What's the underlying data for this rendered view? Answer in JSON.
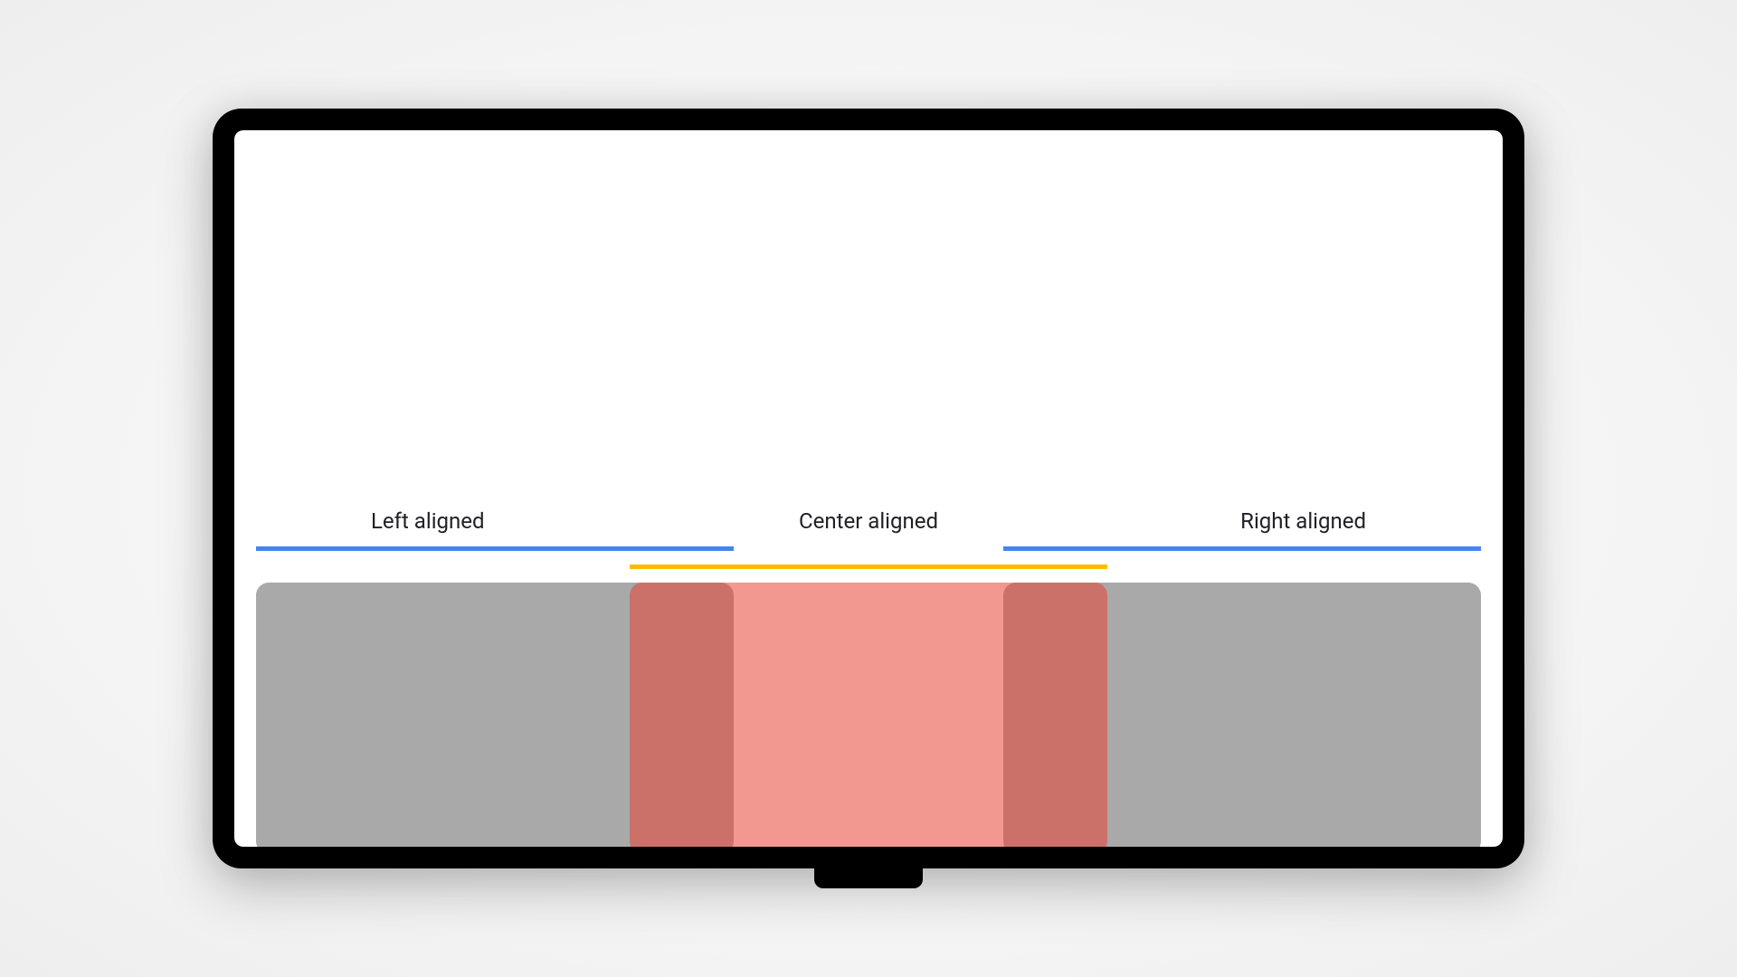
{
  "labels": {
    "left": "Left aligned",
    "center": "Center aligned",
    "right": "Right aligned"
  },
  "colors": {
    "rule_outer": "#4285F4",
    "rule_center": "#FBBC04",
    "card_gray": "#A9A9A9",
    "card_center": "rgba(234,67,53,0.55)"
  }
}
